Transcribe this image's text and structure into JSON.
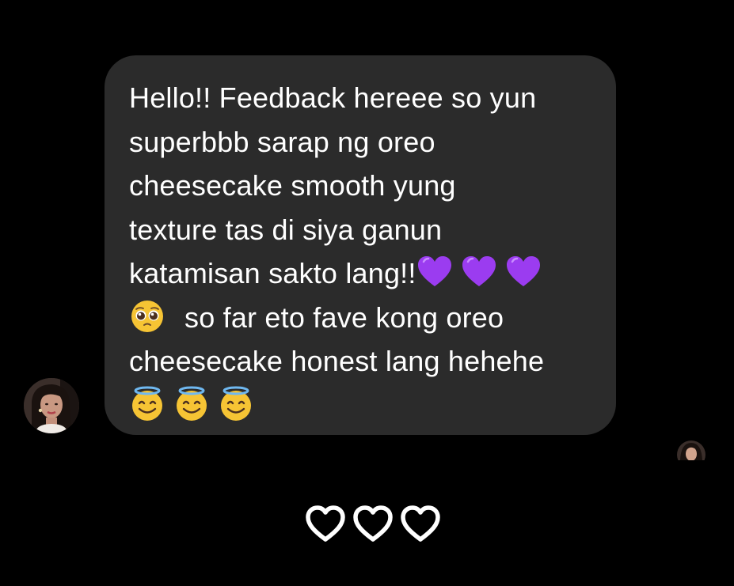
{
  "message": {
    "lines": [
      "Hello!! Feedback hereee so yun",
      "superbbb sarap ng oreo",
      "cheesecake smooth yung",
      "texture tas di siya ganun",
      "katamisan sakto lang!!",
      "so far eto fave kong oreo",
      "cheesecake honest lang hehehe"
    ],
    "inline_emojis": {
      "line5": [
        "purple-heart",
        "purple-heart",
        "purple-heart"
      ],
      "line6_prefix": "pleading-face",
      "line8": [
        "smiling-face-with-halo",
        "smiling-face-with-halo",
        "smiling-face-with-halo"
      ]
    }
  },
  "reactions": [
    "white-heart",
    "white-heart",
    "white-heart"
  ],
  "colors": {
    "background": "#000000",
    "bubble": "#2b2b2b",
    "text": "#ffffff",
    "purple_heart": "#9b3cf0",
    "emoji_yellow": "#f6c434",
    "halo_blue": "#6fb8f0"
  }
}
